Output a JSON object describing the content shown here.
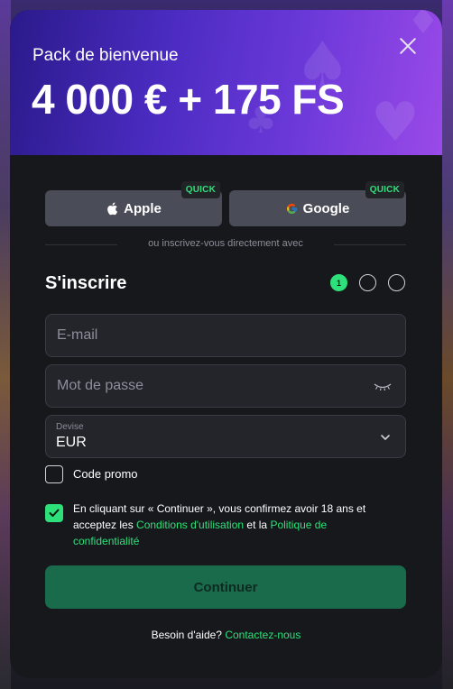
{
  "banner": {
    "subtitle": "Pack de bienvenue",
    "headline": "4 000 € + 175 FS",
    "close_icon": "close-icon"
  },
  "social": {
    "apple_label": "Apple",
    "google_label": "Google",
    "quick_badge": "QUICK",
    "divider_text": "ou inscrivez-vous directement avec"
  },
  "form": {
    "title": "S'inscrire",
    "steps": [
      "1",
      "",
      ""
    ],
    "email_placeholder": "E-mail",
    "password_placeholder": "Mot de passe",
    "currency_label": "Devise",
    "currency_value": "EUR",
    "promo_label": "Code promo",
    "promo_checked": false,
    "terms_checked": true,
    "terms_prefix": "En cliquant sur « Continuer », vous confirmez avoir 18 ans et acceptez les ",
    "terms_link1": "Conditions d'utilisation",
    "terms_mid": " et la ",
    "terms_link2": "Politique de confidentialité",
    "continue_label": "Continuer"
  },
  "help": {
    "text": "Besoin d'aide? ",
    "link": "Contactez-nous"
  },
  "colors": {
    "accent": "#2ee07a",
    "modal_bg": "#17181c",
    "banner_start": "#2a1a8a",
    "banner_end": "#9a4ae8",
    "continue_bg": "#1a6a4c"
  }
}
